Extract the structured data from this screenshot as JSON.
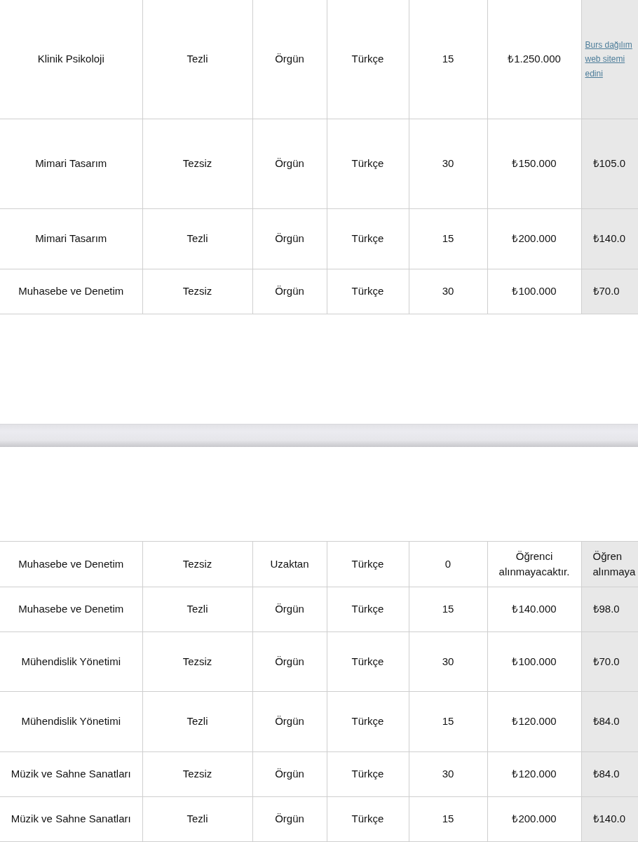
{
  "pages": [
    {
      "rows": [
        {
          "cells": [
            "Klinik Psikoloji",
            "Tezli",
            "Örgün",
            "Türkçe",
            "15",
            "₺1.250.000"
          ],
          "last": {
            "kind": "link",
            "text": "Burs dağılım\nweb sitemi\nedini"
          }
        },
        {
          "cells": [
            "Mimari Tasarım",
            "Tezsiz",
            "Örgün",
            "Türkçe",
            "30",
            "₺150.000"
          ],
          "last": {
            "kind": "text",
            "text": "₺105.0"
          }
        },
        {
          "cells": [
            "Mimari Tasarım",
            "Tezli",
            "Örgün",
            "Türkçe",
            "15",
            "₺200.000"
          ],
          "last": {
            "kind": "text",
            "text": "₺140.0"
          }
        },
        {
          "cells": [
            "Muhasebe ve Denetim",
            "Tezsiz",
            "Örgün",
            "Türkçe",
            "30",
            "₺100.000"
          ],
          "last": {
            "kind": "text",
            "text": "₺70.0"
          }
        }
      ]
    },
    {
      "rows": [
        {
          "cells": [
            "Muhasebe ve Denetim",
            "Tezsiz",
            "Uzaktan",
            "Türkçe",
            "0",
            "Öğrenci\nalınmayacaktır."
          ],
          "last": {
            "kind": "text",
            "text": "Öğren\nalınmaya"
          }
        },
        {
          "cells": [
            "Muhasebe ve Denetim",
            "Tezli",
            "Örgün",
            "Türkçe",
            "15",
            "₺140.000"
          ],
          "last": {
            "kind": "text",
            "text": "₺98.0"
          }
        },
        {
          "cells": [
            "Mühendislik Yönetimi",
            "Tezsiz",
            "Örgün",
            "Türkçe",
            "30",
            "₺100.000"
          ],
          "last": {
            "kind": "text",
            "text": "₺70.0"
          }
        },
        {
          "cells": [
            "Mühendislik Yönetimi",
            "Tezli",
            "Örgün",
            "Türkçe",
            "15",
            "₺120.000"
          ],
          "last": {
            "kind": "text",
            "text": "₺84.0"
          }
        },
        {
          "cells": [
            "Müzik ve Sahne Sanatları",
            "Tezsiz",
            "Örgün",
            "Türkçe",
            "30",
            "₺120.000"
          ],
          "last": {
            "kind": "text",
            "text": "₺84.0"
          }
        },
        {
          "cells": [
            "Müzik ve Sahne Sanatları",
            "Tezli",
            "Örgün",
            "Türkçe",
            "15",
            "₺200.000"
          ],
          "last": {
            "kind": "text",
            "text": "₺140.0"
          }
        }
      ]
    }
  ]
}
